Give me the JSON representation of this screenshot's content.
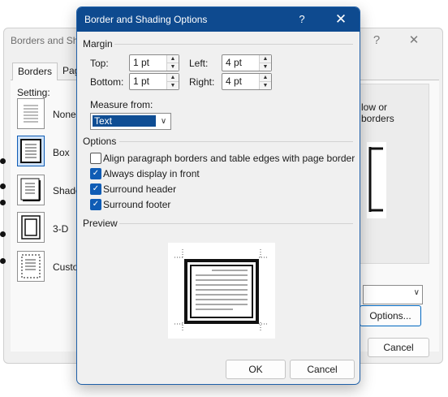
{
  "background_dialog": {
    "title": "Borders and Sha",
    "help": "?",
    "close": "✕",
    "tabs": [
      "Borders",
      "Pag"
    ],
    "setting_label": "Setting:",
    "settings": [
      "None",
      "Box",
      "Shado",
      "3-D",
      "Custo"
    ],
    "preview_text_line1": "low or",
    "preview_text_line2": "borders",
    "options_button": "Options...",
    "cancel_button": "Cancel"
  },
  "dialog": {
    "title": "Border and Shading Options",
    "help": "?",
    "close": "✕",
    "margin": {
      "group_label": "Margin",
      "top_label": "Top:",
      "top_value": "1 pt",
      "left_label": "Left:",
      "left_value": "4 pt",
      "bottom_label": "Bottom:",
      "bottom_value": "1 pt",
      "right_label": "Right:",
      "right_value": "4 pt"
    },
    "measure_from": {
      "label": "Measure from:",
      "value": "Text"
    },
    "options": {
      "group_label": "Options",
      "items": [
        {
          "label": "Align paragraph borders and table edges with page border",
          "checked": false
        },
        {
          "label": "Always display in front",
          "checked": true
        },
        {
          "label": "Surround header",
          "checked": true
        },
        {
          "label": "Surround footer",
          "checked": true
        }
      ]
    },
    "preview": {
      "group_label": "Preview"
    },
    "ok_button": "OK",
    "cancel_button": "Cancel"
  },
  "colors": {
    "titlebar": "#0e4a8f",
    "accent": "#0f5cb5",
    "dialog_bg": "#f0f0f0"
  }
}
